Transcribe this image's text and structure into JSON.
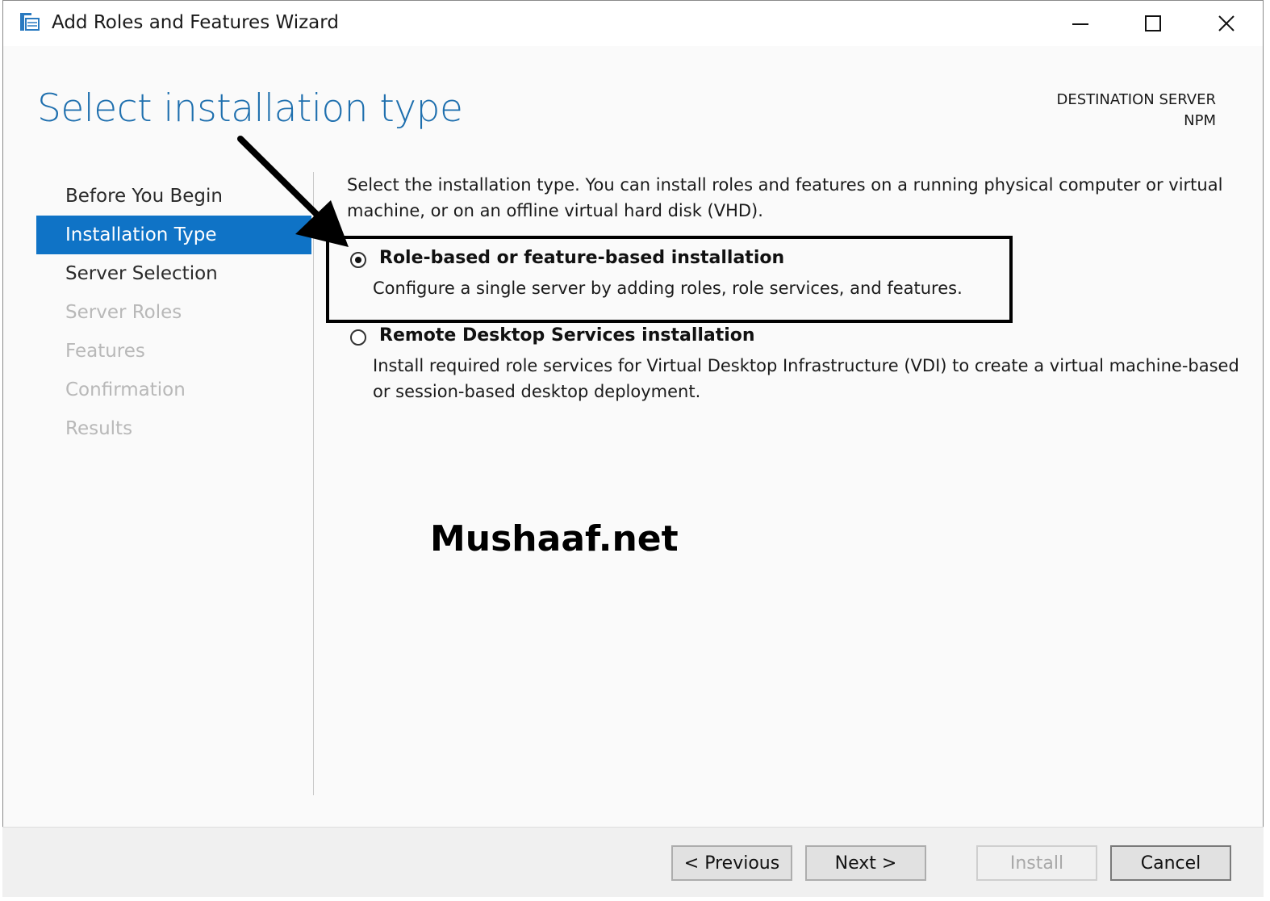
{
  "window": {
    "title": "Add Roles and Features Wizard"
  },
  "header": {
    "page_title": "Select installation type",
    "destination_label": "DESTINATION SERVER",
    "destination_server": "NPM"
  },
  "nav": {
    "items": [
      {
        "label": "Before You Begin",
        "state": "enabled"
      },
      {
        "label": "Installation Type",
        "state": "active"
      },
      {
        "label": "Server Selection",
        "state": "enabled"
      },
      {
        "label": "Server Roles",
        "state": "disabled"
      },
      {
        "label": "Features",
        "state": "disabled"
      },
      {
        "label": "Confirmation",
        "state": "disabled"
      },
      {
        "label": "Results",
        "state": "disabled"
      }
    ]
  },
  "content": {
    "intro_line1": "Select the installation type. You can install roles and features on a running physical computer or virtual",
    "intro_line2": "machine, or on an offline virtual hard disk (VHD).",
    "options": [
      {
        "title": "Role-based or feature-based installation",
        "desc_line1": "Configure a single server by adding roles, role services, and features.",
        "desc_line2": "",
        "selected": true
      },
      {
        "title": "Remote Desktop Services installation",
        "desc_line1": "Install required role services for Virtual Desktop Infrastructure (VDI) to create a virtual machine-based",
        "desc_line2": "or session-based desktop deployment.",
        "selected": false
      }
    ]
  },
  "watermark": "Mushaaf.net",
  "footer": {
    "previous": "< Previous",
    "next": "Next >",
    "install": "Install",
    "cancel": "Cancel"
  },
  "colors": {
    "accent": "#0f73c6",
    "title_blue": "#1e6fae",
    "disabled_text": "#b8b8b8"
  }
}
